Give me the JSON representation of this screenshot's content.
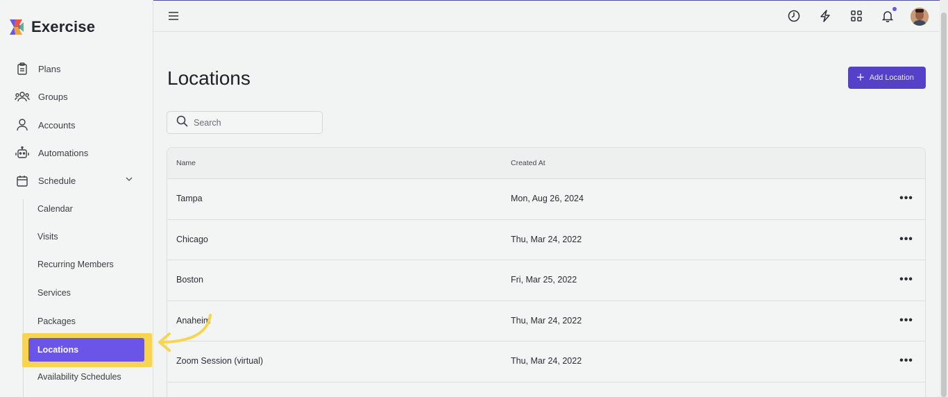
{
  "app": {
    "name": "Exercise"
  },
  "sidebar": {
    "items": [
      {
        "label": "Plans",
        "icon": "clipboard-icon"
      },
      {
        "label": "Groups",
        "icon": "users-icon"
      },
      {
        "label": "Accounts",
        "icon": "user-icon"
      },
      {
        "label": "Automations",
        "icon": "robot-icon"
      },
      {
        "label": "Schedule",
        "icon": "calendar-icon"
      }
    ],
    "schedule_sub": [
      {
        "label": "Calendar"
      },
      {
        "label": "Visits"
      },
      {
        "label": "Recurring Members"
      },
      {
        "label": "Services"
      },
      {
        "label": "Packages"
      },
      {
        "label": "Locations",
        "active": true
      },
      {
        "label": "Availability Schedules"
      }
    ]
  },
  "topbar": {
    "icons": [
      "clock-icon",
      "bolt-icon",
      "grid-icon",
      "bell-icon"
    ],
    "notification_dot_color": "#6a55e8"
  },
  "main": {
    "title": "Locations",
    "add_button_label": "Add Location",
    "search_placeholder": "Search",
    "table": {
      "columns": [
        "Name",
        "Created At"
      ],
      "rows": [
        {
          "name": "Tampa",
          "created_at": "Mon, Aug 26, 2024"
        },
        {
          "name": "Chicago",
          "created_at": "Thu, Mar 24, 2022"
        },
        {
          "name": "Boston",
          "created_at": "Fri, Mar 25, 2022"
        },
        {
          "name": "Anaheim",
          "created_at": "Thu, Mar 24, 2022"
        },
        {
          "name": "Zoom Session (virtual)",
          "created_at": "Thu, Mar 24, 2022"
        }
      ]
    }
  },
  "colors": {
    "accent": "#6a55e8",
    "button": "#5441c7",
    "highlight": "#f7d553"
  }
}
